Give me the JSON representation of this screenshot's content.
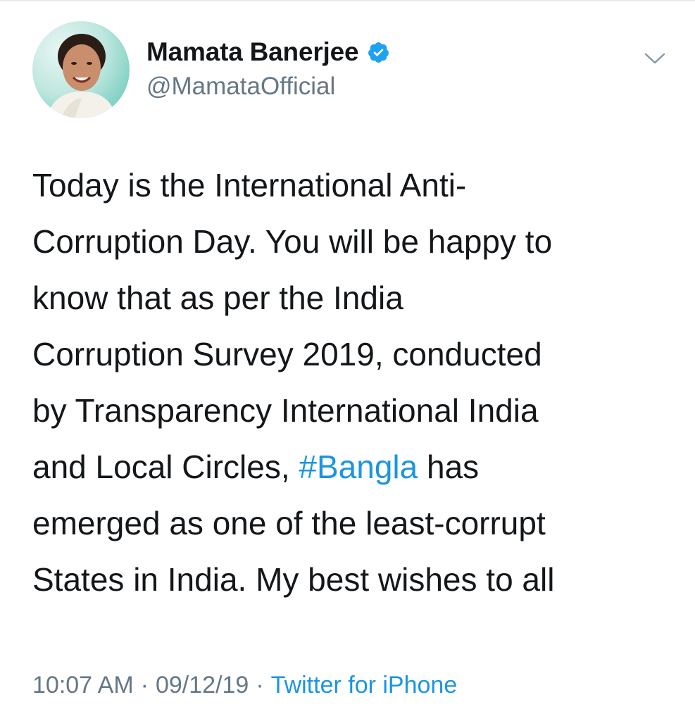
{
  "tweet": {
    "author": {
      "display_name": "Mamata Banerjee",
      "handle": "@MamataOfficial",
      "verified_icon": "verified-badge-icon",
      "avatar_icon": "profile-avatar"
    },
    "text_lines": [
      [
        "Today is the International Anti-"
      ],
      [
        "Corruption Day. You will be happy to"
      ],
      [
        "know that as per the India"
      ],
      [
        "Corruption Survey 2019, conducted"
      ],
      [
        "by Transparency International India"
      ],
      [
        "and Local Circles, ",
        "#Bangla",
        " has"
      ],
      [
        "emerged as one of the least-corrupt"
      ],
      [
        "States in India. My best wishes to all"
      ]
    ],
    "hashtag": "#Bangla",
    "time": "10:07 AM",
    "separator": "·",
    "date": "09/12/19",
    "source": "Twitter for iPhone",
    "menu_icon": "chevron-down-icon"
  },
  "colors": {
    "text": "#14171a",
    "secondary": "#657786",
    "link": "#1b95e0",
    "verified": "#1da1f2"
  }
}
